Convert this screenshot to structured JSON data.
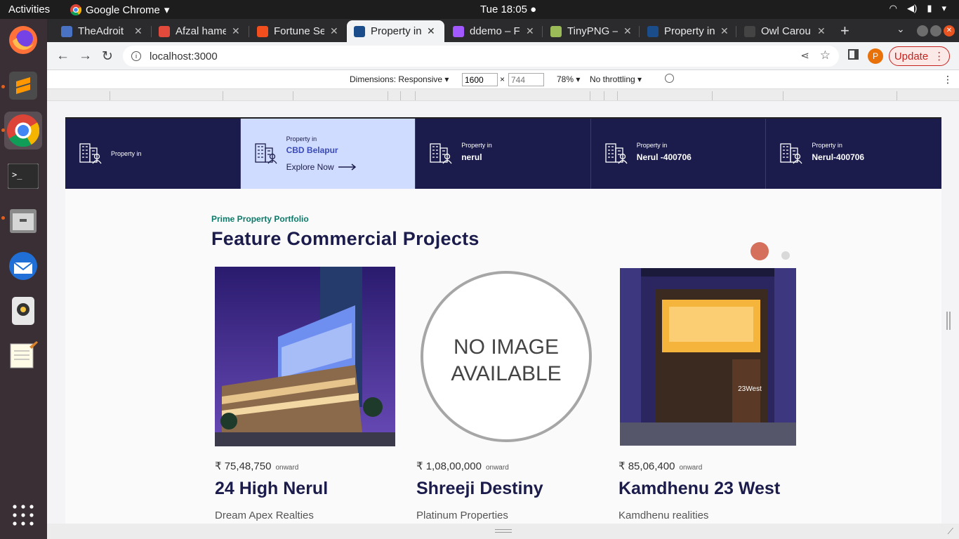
{
  "os": {
    "activities": "Activities",
    "app_name": "Google Chrome",
    "clock": "Tue 18:05"
  },
  "browser": {
    "tabs": [
      {
        "title": "TheAdroit",
        "color": "#4a72c2"
      },
      {
        "title": "Afzal hame",
        "color": "#e24b3c"
      },
      {
        "title": "Fortune Se",
        "color": "#f24e1e"
      },
      {
        "title": "Property in",
        "color": "#1b4d8a"
      },
      {
        "title": "ddemo – Fi",
        "color": "#a259ff"
      },
      {
        "title": "TinyPNG – ",
        "color": "#9bbb59"
      },
      {
        "title": "Property in",
        "color": "#1b4d8a"
      },
      {
        "title": "Owl Carou",
        "color": "#444444"
      }
    ],
    "url": "localhost:3000",
    "update_label": "Update",
    "profile_initial": "P"
  },
  "devtools": {
    "dimensions_label": "Dimensions: Responsive",
    "width_value": "1600",
    "height_placeholder": "744",
    "times": "×",
    "zoom": "78%",
    "throttling": "No throttling"
  },
  "page": {
    "locations": [
      {
        "pre": "Property in",
        "name": ""
      },
      {
        "pre": "Property in",
        "name": "CBD Belapur",
        "explore": "Explore Now"
      },
      {
        "pre": "Property in",
        "name": "nerul"
      },
      {
        "pre": "Property in",
        "name": "Nerul -400706"
      },
      {
        "pre": "Property in",
        "name": "Nerul-400706"
      }
    ],
    "eyebrow": "Prime Property Portfolio",
    "section_title": "Feature Commercial Projects",
    "no_image_text_1": "NO IMAGE",
    "no_image_text_2": "AVAILABLE",
    "cards": [
      {
        "price": "₹ 75,48,750",
        "suffix": "onward",
        "name": "24 High Nerul",
        "developer": "Dream Apex Realties"
      },
      {
        "price": "₹ 1,08,00,000",
        "suffix": "onward",
        "name": "Shreeji Destiny",
        "developer": "Platinum Properties"
      },
      {
        "price": "₹ 85,06,400",
        "suffix": "onward",
        "name": "Kamdhenu 23 West",
        "developer": "Kamdhenu realities"
      }
    ],
    "colors": {
      "navy": "#1b1c4b",
      "highlight": "#cfdcff",
      "teal": "#0c7a6a",
      "active_dot": "#d4705c"
    }
  }
}
